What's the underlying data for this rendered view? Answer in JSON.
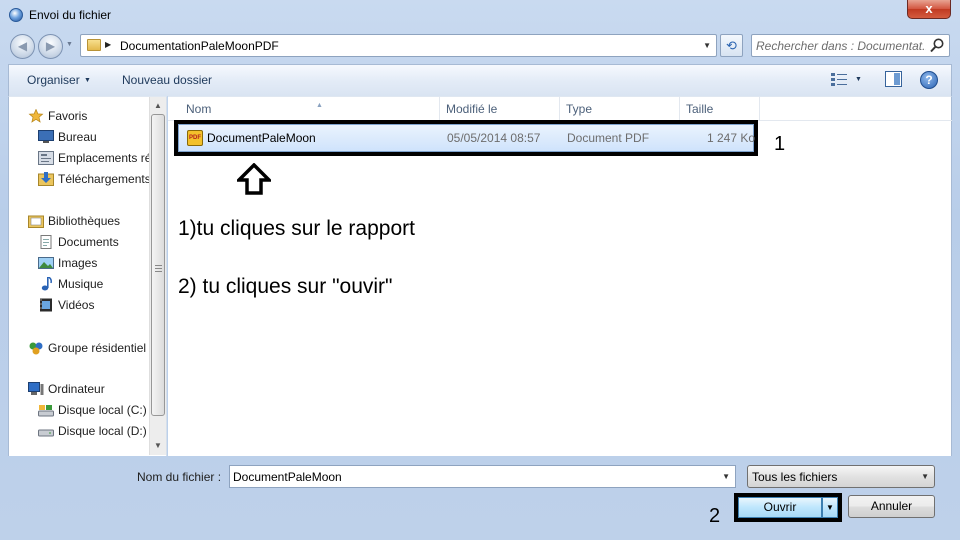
{
  "window": {
    "title": "Envoi du fichier",
    "close_label": "x"
  },
  "nav": {
    "back_glyph": "◀",
    "forward_glyph": "▶",
    "path": "DocumentationPaleMoonPDF",
    "search_placeholder": "Rechercher dans : Documentat..."
  },
  "toolbar": {
    "organiser": "Organiser",
    "new_folder": "Nouveau dossier",
    "help": "?"
  },
  "sidebar": {
    "items": [
      {
        "label": "Favoris",
        "icon": "star-icon"
      },
      {
        "label": "Bureau",
        "icon": "desktop-icon"
      },
      {
        "label": "Emplacements ré",
        "icon": "recent-places-icon"
      },
      {
        "label": "Téléchargements",
        "icon": "downloads-icon"
      },
      {
        "label": "Bibliothèques",
        "icon": "libraries-icon"
      },
      {
        "label": "Documents",
        "icon": "documents-icon"
      },
      {
        "label": "Images",
        "icon": "pictures-icon"
      },
      {
        "label": "Musique",
        "icon": "music-icon"
      },
      {
        "label": "Vidéos",
        "icon": "videos-icon"
      },
      {
        "label": "Groupe résidentiel",
        "icon": "homegroup-icon"
      },
      {
        "label": "Ordinateur",
        "icon": "computer-icon"
      },
      {
        "label": "Disque local (C:)",
        "icon": "drive-c-icon"
      },
      {
        "label": "Disque local (D:)",
        "icon": "drive-d-icon"
      }
    ]
  },
  "file_list": {
    "columns": [
      "Nom",
      "Modifié le",
      "Type",
      "Taille"
    ],
    "rows": [
      {
        "name": "DocumentPaleMoon",
        "modified": "05/05/2014 08:57",
        "type": "Document PDF",
        "size": "1 247 Ko",
        "icon": "pdf-icon"
      }
    ]
  },
  "annotations": {
    "marker1": "1",
    "marker2": "2",
    "step1": "1)tu cliques sur le rapport",
    "step2": "2) tu cliques sur \"ouvir\""
  },
  "footer": {
    "filename_label": "Nom du fichier :",
    "filename_value": "DocumentPaleMoon",
    "filter_value": "Tous les fichiers",
    "open_label": "Ouvrir",
    "cancel_label": "Annuler"
  },
  "colors": {
    "accent": "#3c7fb1",
    "selection": "#cfe3fc",
    "close_button": "#c03a22"
  }
}
